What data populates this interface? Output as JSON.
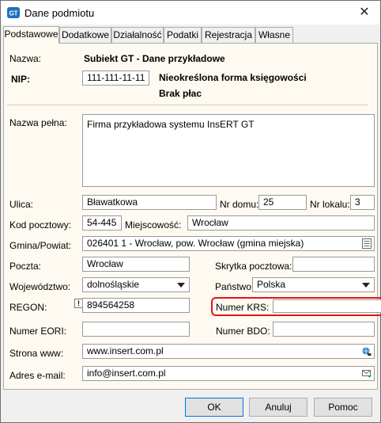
{
  "window": {
    "title": "Dane podmiotu",
    "icon_text": "GT",
    "close_glyph": "✕"
  },
  "tabs": [
    {
      "label": "Podstawowe"
    },
    {
      "label": "Dodatkowe"
    },
    {
      "label": "Działalność"
    },
    {
      "label": "Podatki"
    },
    {
      "label": "Rejestracja"
    },
    {
      "label": "Własne"
    }
  ],
  "form": {
    "nazwa_label": "Nazwa:",
    "nazwa_value": "Subiekt GT - Dane przykładowe",
    "nip_label": "NIP:",
    "nip_value": "111-111-11-11",
    "forma_value": "Nieokreślona forma księgowości",
    "platy_value": "Brak płac",
    "nazwa_pelna_label": "Nazwa pełna:",
    "nazwa_pelna_value": "Firma przykładowa systemu InsERT GT",
    "ulica_label": "Ulica:",
    "ulica_value": "Bławatkowa",
    "nr_domu_label": "Nr domu:",
    "nr_domu_value": "25",
    "nr_lokalu_label": "Nr lokalu:",
    "nr_lokalu_value": "3",
    "kod_label": "Kod pocztowy:",
    "kod_value": "54-445",
    "miejscowosc_label": "Miejscowość:",
    "miejscowosc_value": "Wrocław",
    "gmina_label": "Gmina/Powiat:",
    "gmina_value": "026401 1 - Wrocław, pow. Wrocław (gmina miejska)",
    "poczta_label": "Poczta:",
    "poczta_value": "Wrocław",
    "skrytka_label": "Skrytka pocztowa:",
    "skrytka_value": "",
    "woj_label": "Województwo:",
    "woj_value": "dolnośląskie",
    "panstwo_label": "Państwo:",
    "panstwo_value": "Polska",
    "regon_label": "REGON:",
    "regon_value": "894564258",
    "regon_marker": "!",
    "krs_label": "Numer KRS:",
    "krs_value": "",
    "eori_label": "Numer EORI:",
    "eori_value": "",
    "bdo_label": "Numer BDO:",
    "bdo_value": "",
    "www_label": "Strona www:",
    "www_value": "www.insert.com.pl",
    "email_label": "Adres e-mail:",
    "email_value": "info@insert.com.pl"
  },
  "buttons": {
    "ok": "OK",
    "cancel": "Anuluj",
    "help": "Pomoc"
  },
  "colors": {
    "panel_bg": "#fefaf1",
    "highlight": "#e0161b",
    "accent": "#0078d7"
  }
}
